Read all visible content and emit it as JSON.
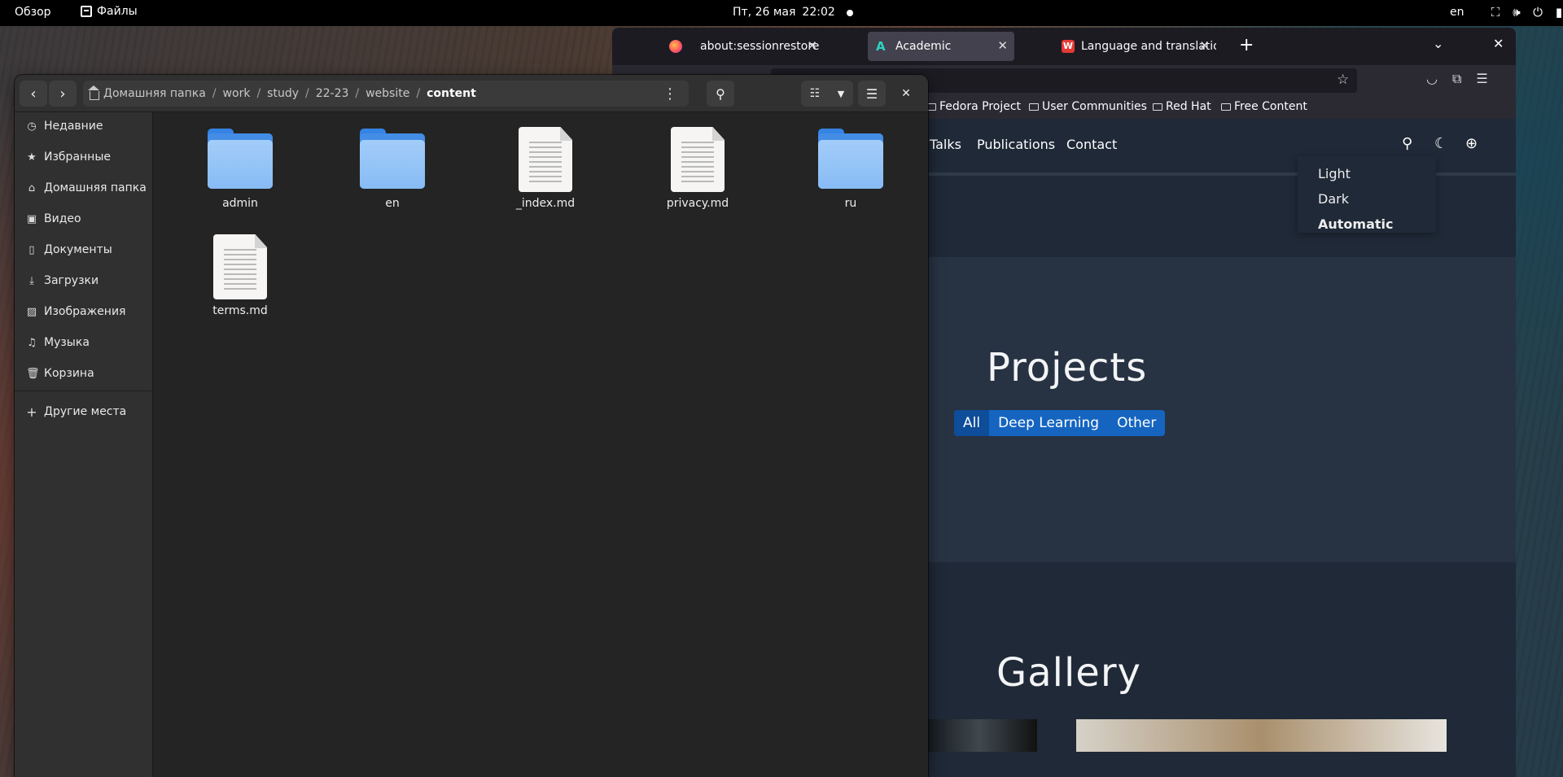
{
  "topbar": {
    "activities": "Обзор",
    "app_name": "Файлы",
    "date": "Пт, 26 мая",
    "time": "22:02",
    "lang": "en",
    "tray_icons": [
      "network-icon",
      "volume-icon",
      "power-icon",
      "battery-icon"
    ]
  },
  "browser": {
    "tabs": [
      {
        "title": "about:sessionrestore",
        "icon": "firefox-icon"
      },
      {
        "title": "Academic",
        "icon": "academic-icon"
      },
      {
        "title": "Language and translation",
        "icon": "wowchemy-icon"
      }
    ],
    "bookmarks": [
      "Fedora Project",
      "User Communities",
      "Red Hat",
      "Free Content"
    ],
    "site": {
      "nav_links": [
        "Talks",
        "Publications",
        "Contact"
      ],
      "theme_menu": [
        "Light",
        "Dark",
        "Automatic"
      ],
      "projects_title": "Projects",
      "filters": [
        "All",
        "Deep Learning",
        "Other"
      ],
      "gallery_title": "Gallery"
    }
  },
  "files": {
    "path": {
      "home": "Домашняя папка",
      "segments": [
        "work",
        "study",
        "22-23",
        "website"
      ],
      "current": "content"
    },
    "sidebar": [
      {
        "label": "Недавние",
        "icon": "clock-icon"
      },
      {
        "label": "Избранные",
        "icon": "star-icon"
      },
      {
        "label": "Домашняя папка",
        "icon": "home-icon"
      },
      {
        "label": "Видео",
        "icon": "video-icon"
      },
      {
        "label": "Документы",
        "icon": "document-icon"
      },
      {
        "label": "Загрузки",
        "icon": "download-icon"
      },
      {
        "label": "Изображения",
        "icon": "image-icon"
      },
      {
        "label": "Музыка",
        "icon": "music-icon"
      },
      {
        "label": "Корзина",
        "icon": "trash-icon"
      }
    ],
    "other_places": "Другие места",
    "items": [
      {
        "name": "admin",
        "type": "folder"
      },
      {
        "name": "en",
        "type": "folder"
      },
      {
        "name": "_index.md",
        "type": "file"
      },
      {
        "name": "privacy.md",
        "type": "file"
      },
      {
        "name": "ru",
        "type": "folder"
      },
      {
        "name": "terms.md",
        "type": "file"
      }
    ]
  }
}
